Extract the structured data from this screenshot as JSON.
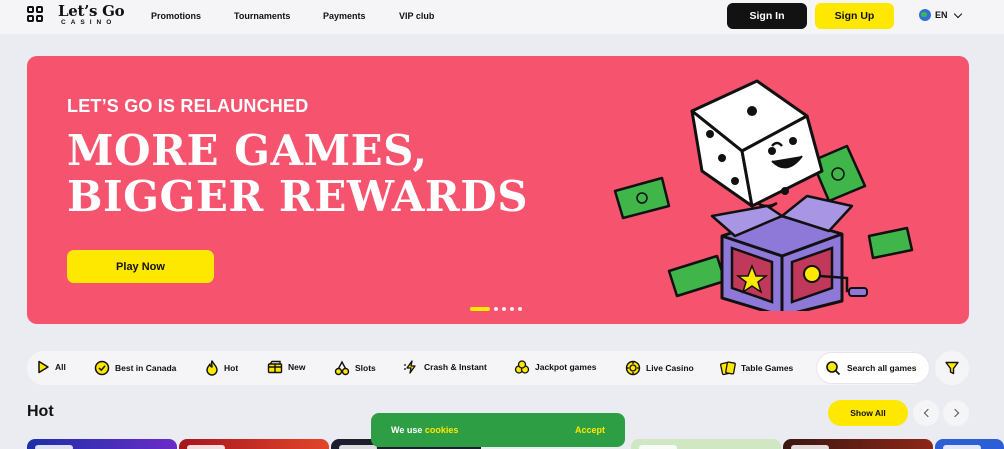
{
  "header": {
    "logo_text": "Let’s Go",
    "logo_sub": "CASINO",
    "nav": [
      "Promotions",
      "Tournaments",
      "Payments",
      "VIP club"
    ],
    "sign_in": "Sign In",
    "sign_up": "Sign Up",
    "language": "EN"
  },
  "banner": {
    "kicker": "LET’S GO IS RELAUNCHED",
    "title_line1": "MORE GAMES,",
    "title_line2": "BIGGER REWARDS",
    "cta": "Play Now",
    "slides_total": 5,
    "slide_active": 1
  },
  "categories": [
    {
      "label": "All",
      "icon": "play-triangle-icon"
    },
    {
      "label": "Best in Canada",
      "icon": "badge-check-icon"
    },
    {
      "label": "Hot",
      "icon": "flame-icon"
    },
    {
      "label": "New",
      "icon": "gift-box-icon"
    },
    {
      "label": "Slots",
      "icon": "cherries-icon"
    },
    {
      "label": "Crash & Instant",
      "icon": "lightning-icon"
    },
    {
      "label": "Jackpot games",
      "icon": "coins-icon"
    },
    {
      "label": "Live Casino",
      "icon": "poker-chip-icon"
    },
    {
      "label": "Table Games",
      "icon": "cards-icon"
    }
  ],
  "search": {
    "label": "Search all games",
    "icon": "search-icon"
  },
  "hot": {
    "title": "Hot",
    "show_all": "Show All"
  },
  "cookie": {
    "prefix": "We use",
    "link": "cookies",
    "accept": "Accept"
  },
  "colors": {
    "banner_bg": "#f6546e",
    "accent_yellow": "#ffe800",
    "cookie_green": "#2e9e45"
  }
}
